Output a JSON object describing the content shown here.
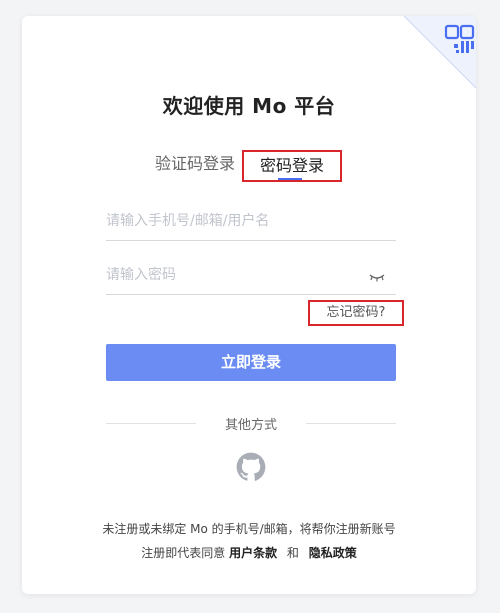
{
  "title": "欢迎使用 Mo 平台",
  "tabs": {
    "code_login": "验证码登录",
    "password_login": "密码登录"
  },
  "form": {
    "account_placeholder": "请输入手机号/邮箱/用户名",
    "password_placeholder": "请输入密码",
    "forgot_password": "忘记密码?",
    "submit_label": "立即登录"
  },
  "other_methods": {
    "label": "其他方式",
    "icon": "github-icon"
  },
  "footer": {
    "notice": "未注册或未绑定 Mo 的手机号/邮箱，将帮你注册新账号",
    "agree_prefix": "注册即代表同意",
    "terms": "用户条款",
    "and": "和",
    "privacy": "隐私政策"
  },
  "colors": {
    "accent": "#6b8df3",
    "tab_underline": "#4a6ef0",
    "highlight_box": "#d9262c"
  },
  "icons": {
    "corner": "qr-code-icon",
    "password_toggle": "eye-closed-icon"
  }
}
